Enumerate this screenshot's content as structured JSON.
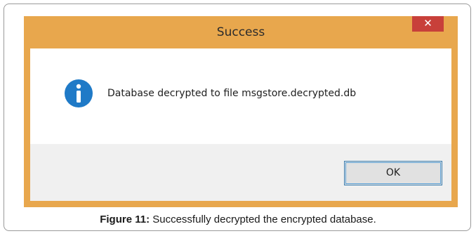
{
  "dialog": {
    "title": "Success",
    "close_glyph": "✕",
    "message": "Database decrypted to file msgstore.decrypted.db",
    "icon": "info-icon",
    "ok_label": "OK"
  },
  "caption": {
    "label": "Figure 11:",
    "text": " Successfully decrypted the encrypted database."
  },
  "colors": {
    "titlebar": "#e8a74d",
    "close_button": "#c8403a",
    "info_icon": "#1f7ac7",
    "footer": "#f0f0f0",
    "ok_border": "#3c7fb1"
  }
}
